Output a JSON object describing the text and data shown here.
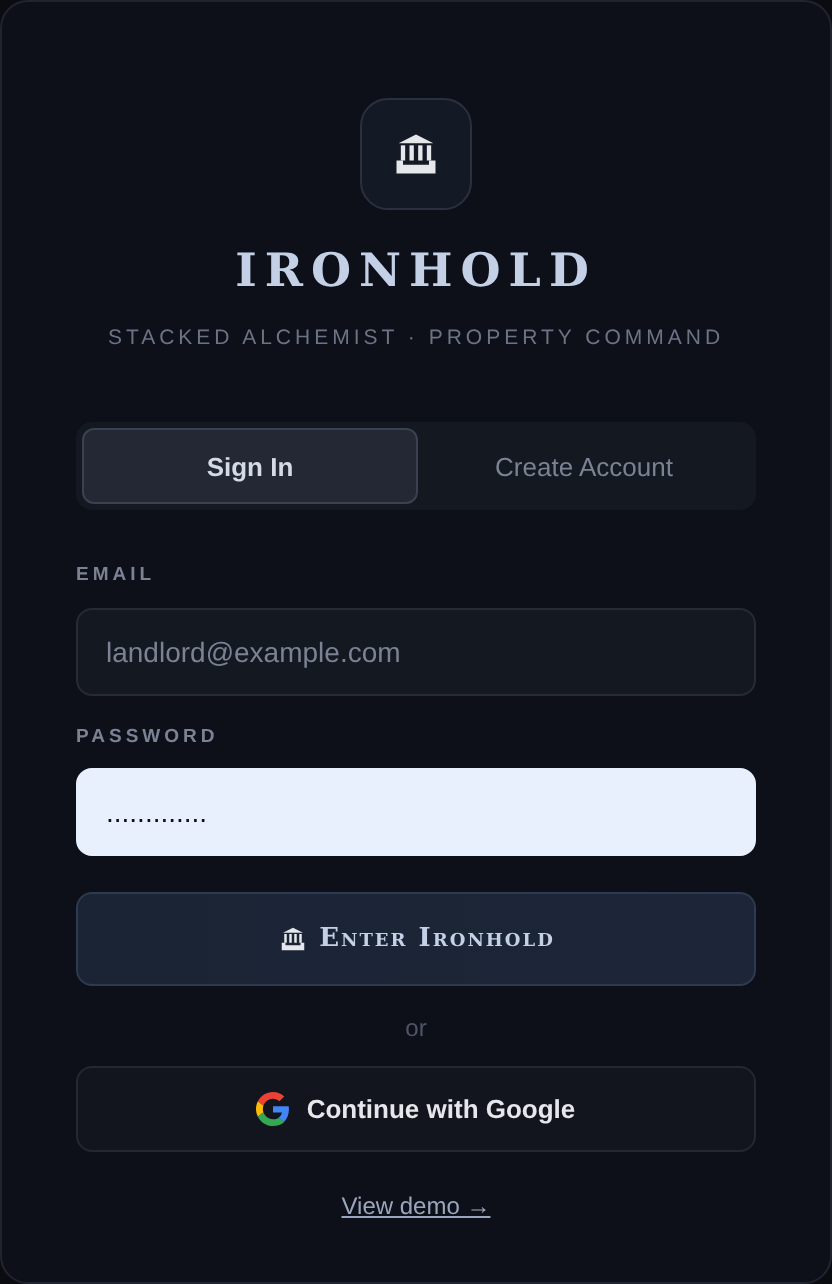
{
  "brand": {
    "title": "IRONHOLD",
    "subtitle": "STACKED ALCHEMIST · PROPERTY COMMAND"
  },
  "tabs": [
    {
      "label": "Sign In",
      "selected": true
    },
    {
      "label": "Create Account",
      "selected": false
    }
  ],
  "fields": [
    {
      "label": "EMAIL",
      "placeholder": "landlord@example.com",
      "focused": false
    },
    {
      "label": "PASSWORD",
      "value": ".............",
      "focused": true
    }
  ],
  "submit": {
    "label": "Enter Ironhold"
  },
  "divider": "or",
  "google": {
    "label": "Continue with Google"
  },
  "demo_link": "View demo →"
}
